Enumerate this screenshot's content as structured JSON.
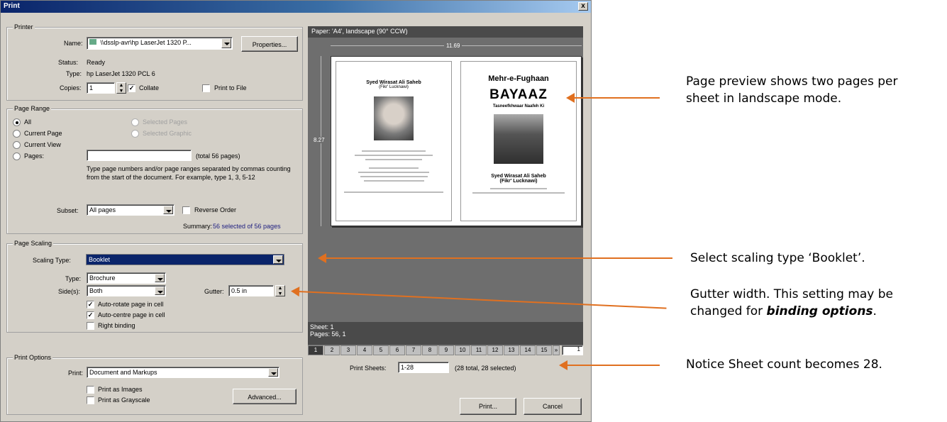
{
  "window": {
    "title": "Print",
    "close_label": "x"
  },
  "printer": {
    "group_label": "Printer",
    "name_label": "Name:",
    "name_value": "\\\\dsslp-avr\\hp LaserJet 1320 P...",
    "properties_label": "Properties...",
    "status_label": "Status:",
    "status_value": "Ready",
    "type_label": "Type:",
    "type_value": "hp LaserJet 1320 PCL 6",
    "copies_label": "Copies:",
    "copies_value": "1",
    "collate_label": "Collate",
    "print_to_file_label": "Print to File"
  },
  "page_range": {
    "group_label": "Page Range",
    "all_label": "All",
    "current_page_label": "Current Page",
    "current_view_label": "Current View",
    "pages_label": "Pages:",
    "selected_pages_label": "Selected Pages",
    "selected_graphic_label": "Selected Graphic",
    "total_pages": "(total 56 pages)",
    "help_text": "Type page numbers and/or page ranges separated by commas counting from the start of the document. For example, type 1, 3, 5-12",
    "subset_label": "Subset:",
    "subset_value": "All pages",
    "reverse_order_label": "Reverse Order",
    "summary_label": "Summary:",
    "summary_value": "56 selected of 56 pages"
  },
  "page_scaling": {
    "group_label": "Page Scaling",
    "scaling_type_label": "Scaling Type:",
    "scaling_type_value": "Booklet",
    "type_label": "Type:",
    "type_value": "Brochure",
    "sides_label": "Side(s):",
    "sides_value": "Both",
    "gutter_label": "Gutter:",
    "gutter_value": "0.5 in",
    "auto_rotate_label": "Auto-rotate page in cell",
    "auto_centre_label": "Auto-centre page in cell",
    "right_binding_label": "Right binding"
  },
  "print_options": {
    "group_label": "Print Options",
    "print_label": "Print:",
    "print_value": "Document and Markups",
    "as_images_label": "Print as Images",
    "grayscale_label": "Print as Grayscale",
    "advanced_label": "Advanced..."
  },
  "preview": {
    "paper_label": "Paper: 'A4', landscape (90° CCW)",
    "width_label": "11.69",
    "height_label": "8.27",
    "left_page": {
      "title": "Syed Wirasat Ali Saheb",
      "subtitle": "(Fikr' Lucknawi)"
    },
    "right_page": {
      "line1": "Mehr-e-Fughaan",
      "line2": "BAYAAZ",
      "line3": "Tasneefkhwaar Naafeh Ki",
      "line4": "Syed Wirasat Ali Saheb",
      "line5": "(Fikr' Lucknawi)"
    },
    "sheet_info": "Sheet: 1",
    "pages_info": "Pages: 56, 1",
    "page_numbers": [
      "1",
      "2",
      "3",
      "4",
      "5",
      "6",
      "7",
      "8",
      "9",
      "10",
      "11",
      "12",
      "13",
      "14",
      "15"
    ],
    "current_page": "1"
  },
  "print_sheets": {
    "label": "Print Sheets:",
    "value": "1-28",
    "summary": "(28 total, 28 selected)"
  },
  "buttons": {
    "print": "Print...",
    "cancel": "Cancel"
  },
  "annotations": {
    "a1": "Page preview shows two pages per sheet in landscape mode.",
    "a2": "Select scaling type ‘Booklet’.",
    "a3_prefix": "Gutter width. This setting may be changed for ",
    "a3_emph": "binding options",
    "a3_suffix": ".",
    "a4": "Notice Sheet count becomes 28."
  },
  "colors": {
    "accent": "#e07020",
    "title_bar": "#0a246a"
  }
}
